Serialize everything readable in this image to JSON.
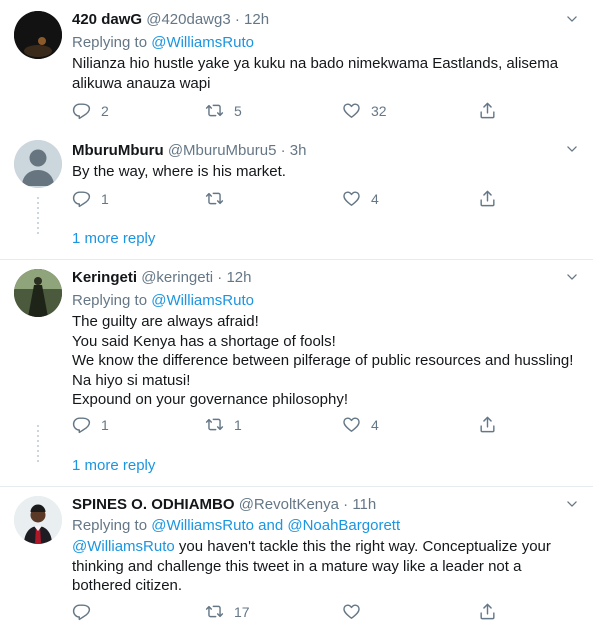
{
  "tweets": [
    {
      "name": "420 dawG",
      "handle": "@420dawg3",
      "time": "12h",
      "replying_prefix": "Replying to ",
      "replying_to": "@WilliamsRuto",
      "text_lines": [
        "Nilianza hio hustle yake ya kuku na bado nimekwama Eastlands, alisema",
        "alikuwa anauza wapi"
      ],
      "replies": "2",
      "retweets": "5",
      "likes": "32"
    },
    {
      "name": "MburuMburu",
      "handle": "@MburuMburu5",
      "time": "3h",
      "text_lines": [
        "By the way, where is his market."
      ],
      "replies": "1",
      "retweets": "",
      "likes": "4",
      "more_replies": "1 more reply"
    },
    {
      "name": "Keringeti",
      "handle": "@keringeti",
      "time": "12h",
      "replying_prefix": "Replying to ",
      "replying_to": "@WilliamsRuto",
      "text_lines": [
        "The guilty are always afraid!",
        "You said Kenya has a shortage of fools!",
        "We know the difference between pilferage of public resources and hussling!",
        "Na hiyo si matusi!",
        "Expound on your governance philosophy!"
      ],
      "replies": "1",
      "retweets": "1",
      "likes": "4",
      "more_replies": "1 more reply"
    },
    {
      "name": "SPINES O. ODHIAMBO",
      "handle": "@RevoltKenya",
      "time": "11h",
      "replying_prefix": "Replying to ",
      "replying_to": "@WilliamsRuto",
      "replying_and": " and ",
      "replying_to_2": "@NoahBargorett",
      "text_mention": "@WilliamsRuto",
      "text_lines": [
        " you haven't tackle this the right way. Conceptualize your",
        "thinking and challenge this tweet in a mature way like a leader not a",
        "bothered citizen."
      ],
      "replies": "",
      "retweets": "17",
      "likes": "",
      "more_replies": ""
    }
  ],
  "separator": "·",
  "colors": {
    "link": "#1b95e0",
    "muted": "#657786",
    "text": "#14171a",
    "border": "#e6ecf0"
  },
  "icons": [
    "reply-icon",
    "retweet-icon",
    "like-icon",
    "share-icon",
    "caret-down-icon"
  ]
}
